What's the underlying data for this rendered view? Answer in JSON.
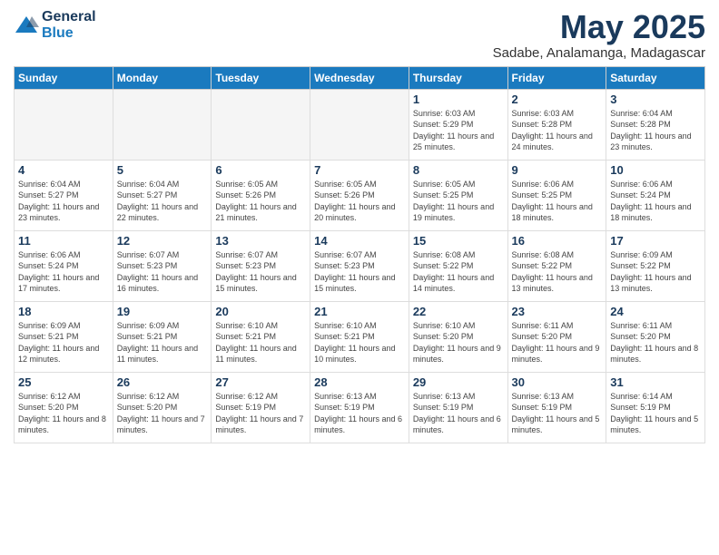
{
  "header": {
    "logo_general": "General",
    "logo_blue": "Blue",
    "month_title": "May 2025",
    "location": "Sadabe, Analamanga, Madagascar"
  },
  "weekdays": [
    "Sunday",
    "Monday",
    "Tuesday",
    "Wednesday",
    "Thursday",
    "Friday",
    "Saturday"
  ],
  "weeks": [
    [
      {
        "day": "",
        "empty": true
      },
      {
        "day": "",
        "empty": true
      },
      {
        "day": "",
        "empty": true
      },
      {
        "day": "",
        "empty": true
      },
      {
        "day": "1",
        "sunrise": "6:03 AM",
        "sunset": "5:29 PM",
        "daylight": "11 hours and 25 minutes."
      },
      {
        "day": "2",
        "sunrise": "6:03 AM",
        "sunset": "5:28 PM",
        "daylight": "11 hours and 24 minutes."
      },
      {
        "day": "3",
        "sunrise": "6:04 AM",
        "sunset": "5:28 PM",
        "daylight": "11 hours and 23 minutes."
      }
    ],
    [
      {
        "day": "4",
        "sunrise": "6:04 AM",
        "sunset": "5:27 PM",
        "daylight": "11 hours and 23 minutes."
      },
      {
        "day": "5",
        "sunrise": "6:04 AM",
        "sunset": "5:27 PM",
        "daylight": "11 hours and 22 minutes."
      },
      {
        "day": "6",
        "sunrise": "6:05 AM",
        "sunset": "5:26 PM",
        "daylight": "11 hours and 21 minutes."
      },
      {
        "day": "7",
        "sunrise": "6:05 AM",
        "sunset": "5:26 PM",
        "daylight": "11 hours and 20 minutes."
      },
      {
        "day": "8",
        "sunrise": "6:05 AM",
        "sunset": "5:25 PM",
        "daylight": "11 hours and 19 minutes."
      },
      {
        "day": "9",
        "sunrise": "6:06 AM",
        "sunset": "5:25 PM",
        "daylight": "11 hours and 18 minutes."
      },
      {
        "day": "10",
        "sunrise": "6:06 AM",
        "sunset": "5:24 PM",
        "daylight": "11 hours and 18 minutes."
      }
    ],
    [
      {
        "day": "11",
        "sunrise": "6:06 AM",
        "sunset": "5:24 PM",
        "daylight": "11 hours and 17 minutes."
      },
      {
        "day": "12",
        "sunrise": "6:07 AM",
        "sunset": "5:23 PM",
        "daylight": "11 hours and 16 minutes."
      },
      {
        "day": "13",
        "sunrise": "6:07 AM",
        "sunset": "5:23 PM",
        "daylight": "11 hours and 15 minutes."
      },
      {
        "day": "14",
        "sunrise": "6:07 AM",
        "sunset": "5:23 PM",
        "daylight": "11 hours and 15 minutes."
      },
      {
        "day": "15",
        "sunrise": "6:08 AM",
        "sunset": "5:22 PM",
        "daylight": "11 hours and 14 minutes."
      },
      {
        "day": "16",
        "sunrise": "6:08 AM",
        "sunset": "5:22 PM",
        "daylight": "11 hours and 13 minutes."
      },
      {
        "day": "17",
        "sunrise": "6:09 AM",
        "sunset": "5:22 PM",
        "daylight": "11 hours and 13 minutes."
      }
    ],
    [
      {
        "day": "18",
        "sunrise": "6:09 AM",
        "sunset": "5:21 PM",
        "daylight": "11 hours and 12 minutes."
      },
      {
        "day": "19",
        "sunrise": "6:09 AM",
        "sunset": "5:21 PM",
        "daylight": "11 hours and 11 minutes."
      },
      {
        "day": "20",
        "sunrise": "6:10 AM",
        "sunset": "5:21 PM",
        "daylight": "11 hours and 11 minutes."
      },
      {
        "day": "21",
        "sunrise": "6:10 AM",
        "sunset": "5:21 PM",
        "daylight": "11 hours and 10 minutes."
      },
      {
        "day": "22",
        "sunrise": "6:10 AM",
        "sunset": "5:20 PM",
        "daylight": "11 hours and 9 minutes."
      },
      {
        "day": "23",
        "sunrise": "6:11 AM",
        "sunset": "5:20 PM",
        "daylight": "11 hours and 9 minutes."
      },
      {
        "day": "24",
        "sunrise": "6:11 AM",
        "sunset": "5:20 PM",
        "daylight": "11 hours and 8 minutes."
      }
    ],
    [
      {
        "day": "25",
        "sunrise": "6:12 AM",
        "sunset": "5:20 PM",
        "daylight": "11 hours and 8 minutes."
      },
      {
        "day": "26",
        "sunrise": "6:12 AM",
        "sunset": "5:20 PM",
        "daylight": "11 hours and 7 minutes."
      },
      {
        "day": "27",
        "sunrise": "6:12 AM",
        "sunset": "5:19 PM",
        "daylight": "11 hours and 7 minutes."
      },
      {
        "day": "28",
        "sunrise": "6:13 AM",
        "sunset": "5:19 PM",
        "daylight": "11 hours and 6 minutes."
      },
      {
        "day": "29",
        "sunrise": "6:13 AM",
        "sunset": "5:19 PM",
        "daylight": "11 hours and 6 minutes."
      },
      {
        "day": "30",
        "sunrise": "6:13 AM",
        "sunset": "5:19 PM",
        "daylight": "11 hours and 5 minutes."
      },
      {
        "day": "31",
        "sunrise": "6:14 AM",
        "sunset": "5:19 PM",
        "daylight": "11 hours and 5 minutes."
      }
    ]
  ],
  "labels": {
    "sunrise": "Sunrise:",
    "sunset": "Sunset:",
    "daylight": "Daylight:"
  }
}
